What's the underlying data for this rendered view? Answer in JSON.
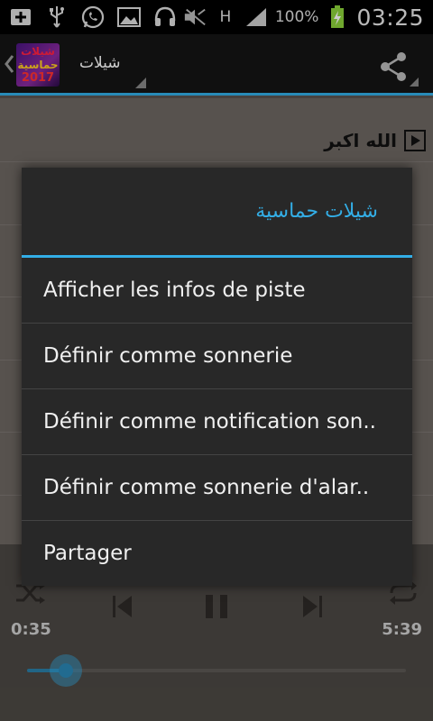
{
  "status_bar": {
    "battery_text": "100%",
    "time": "03:25",
    "network_label": "H",
    "icons": [
      "add-box-icon",
      "usb-icon",
      "whatsapp-icon",
      "image-icon",
      "headset-icon",
      "mute-icon",
      "network-h-icon",
      "signal-icon",
      "battery-charging-icon"
    ]
  },
  "action_bar": {
    "logo_line1": "شيلات",
    "logo_line2": "حماسية",
    "logo_line3": "2017",
    "title": "شيلات",
    "icons": [
      "back-chevron-icon",
      "share-icon"
    ]
  },
  "list": {
    "track_title": "الله اكبر"
  },
  "player": {
    "elapsed": "0:35",
    "duration": "5:39",
    "progress": 0.103,
    "icons": [
      "shuffle-icon",
      "previous-icon",
      "pause-icon",
      "next-icon",
      "repeat-icon"
    ]
  },
  "dialog": {
    "title": "شيلات حماسية",
    "items": [
      {
        "label": "Afficher les infos de piste"
      },
      {
        "label": "Définir comme sonnerie"
      },
      {
        "label": "Définir comme notification son.."
      },
      {
        "label": "Définir comme sonnerie d'alar.."
      },
      {
        "label": "Partager"
      }
    ]
  },
  "colors": {
    "accent": "#33aee6",
    "dialog_bg": "#282828",
    "action_bar_bg": "#151515"
  }
}
